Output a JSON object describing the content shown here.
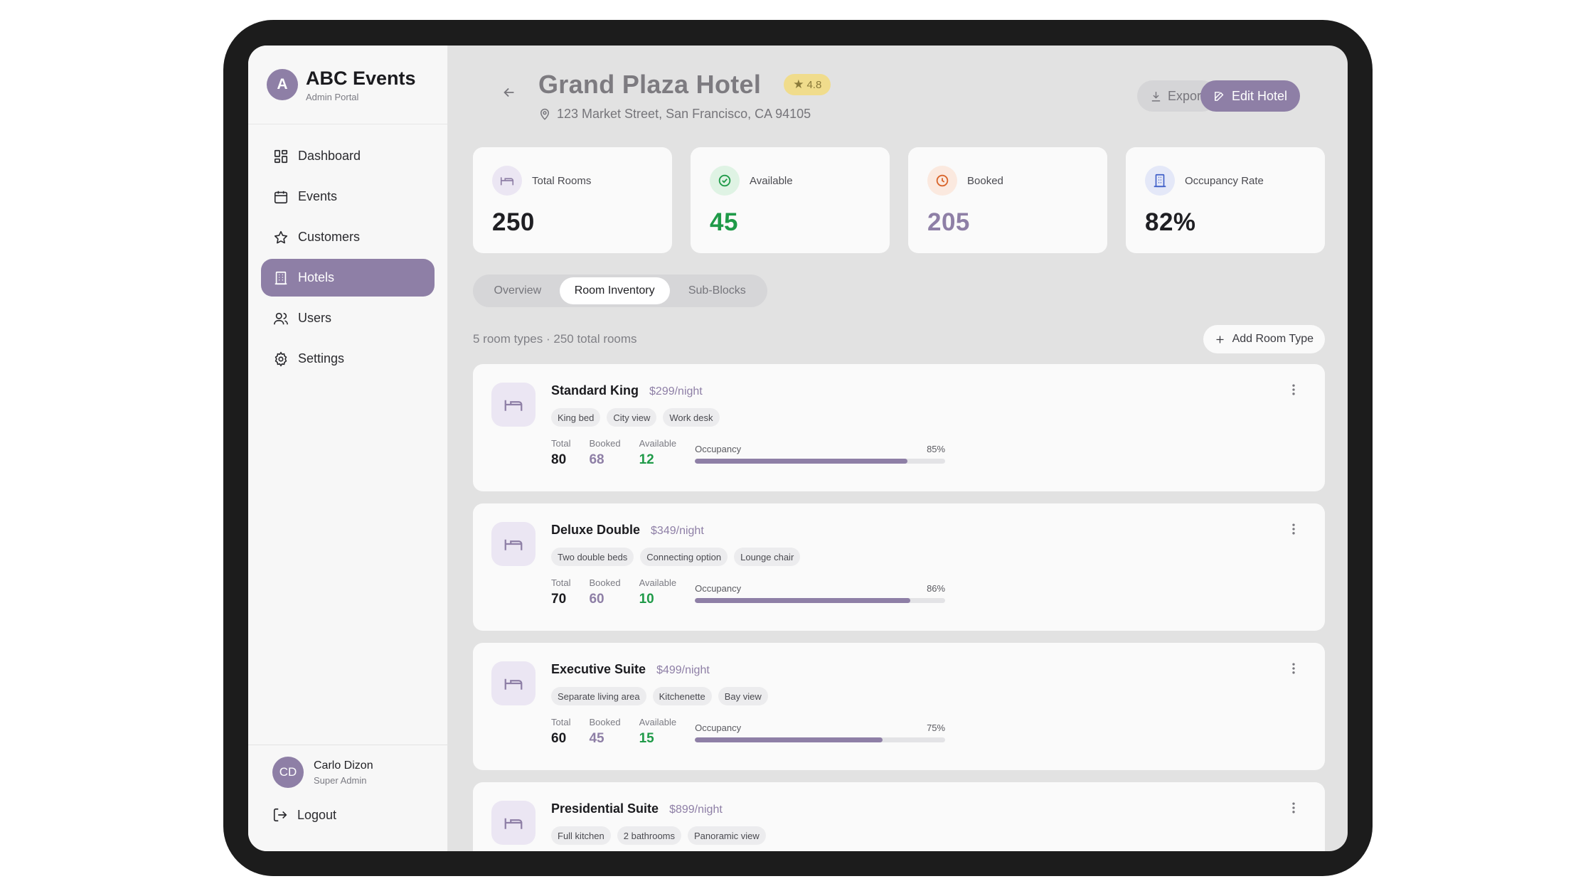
{
  "brand": {
    "avatar": "A",
    "name": "ABC Events",
    "subtitle": "Admin Portal"
  },
  "nav": [
    {
      "label": "Dashboard",
      "icon": "dashboard-icon",
      "active": false
    },
    {
      "label": "Events",
      "icon": "calendar-icon",
      "active": false
    },
    {
      "label": "Customers",
      "icon": "star-icon",
      "active": false
    },
    {
      "label": "Hotels",
      "icon": "building-icon",
      "active": true
    },
    {
      "label": "Users",
      "icon": "users-icon",
      "active": false
    },
    {
      "label": "Settings",
      "icon": "gear-icon",
      "active": false
    }
  ],
  "user": {
    "initials": "CD",
    "name": "Carlo Dizon",
    "role": "Super Admin",
    "logout_label": "Logout"
  },
  "hotel": {
    "name": "Grand Plaza Hotel",
    "rating": "4.8",
    "address": "123 Market Street, San Francisco, CA 94105"
  },
  "actions": {
    "export_label": "Export",
    "edit_label": "Edit Hotel"
  },
  "stats": [
    {
      "label": "Total Rooms",
      "value": "250",
      "color": "#1f1f23",
      "icon": "bed-icon",
      "icon_bg": "#ebe6f3"
    },
    {
      "label": "Available",
      "value": "45",
      "color": "#1f9a48",
      "icon": "check-circle-icon",
      "icon_bg": "#dff3e4"
    },
    {
      "label": "Booked",
      "value": "205",
      "color": "#8e7fa6",
      "icon": "clock-icon",
      "icon_bg": "#fbe9df"
    },
    {
      "label": "Occupancy Rate",
      "value": "82%",
      "color": "#1f1f23",
      "icon": "building-icon",
      "icon_bg": "#e4e8f8"
    }
  ],
  "tabs": [
    {
      "label": "Overview",
      "active": false
    },
    {
      "label": "Room Inventory",
      "active": true
    },
    {
      "label": "Sub-Blocks",
      "active": false
    }
  ],
  "list": {
    "summary": "5 room types · 250 total rooms",
    "add_label": "Add Room Type"
  },
  "labels": {
    "total": "Total",
    "booked": "Booked",
    "available": "Available",
    "occupancy": "Occupancy"
  },
  "rooms": [
    {
      "name": "Standard King",
      "price": "$299/night",
      "tags": [
        "King bed",
        "City view",
        "Work desk"
      ],
      "total": "80",
      "booked": "68",
      "available": "12",
      "occupancy_label": "85%",
      "occupancy": 0.85
    },
    {
      "name": "Deluxe Double",
      "price": "$349/night",
      "tags": [
        "Two double beds",
        "Connecting option",
        "Lounge chair"
      ],
      "total": "70",
      "booked": "60",
      "available": "10",
      "occupancy_label": "86%",
      "occupancy": 0.86
    },
    {
      "name": "Executive Suite",
      "price": "$499/night",
      "tags": [
        "Separate living area",
        "Kitchenette",
        "Bay view"
      ],
      "total": "60",
      "booked": "45",
      "available": "15",
      "occupancy_label": "75%",
      "occupancy": 0.75
    },
    {
      "name": "Presidential Suite",
      "price": "$899/night",
      "tags": [
        "Full kitchen",
        "2 bathrooms",
        "Panoramic view"
      ],
      "total": "",
      "booked": "",
      "available": "",
      "occupancy_label": "",
      "occupancy": 0
    }
  ]
}
